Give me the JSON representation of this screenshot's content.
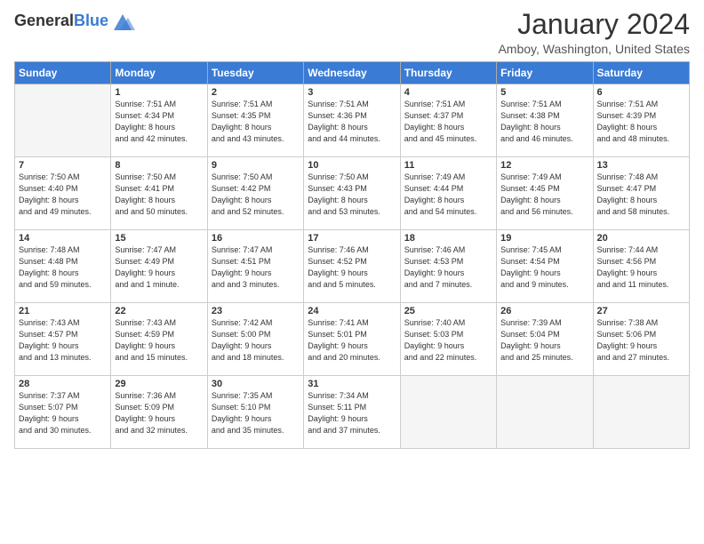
{
  "logo": {
    "general": "General",
    "blue": "Blue"
  },
  "header": {
    "month": "January 2024",
    "location": "Amboy, Washington, United States"
  },
  "days_of_week": [
    "Sunday",
    "Monday",
    "Tuesday",
    "Wednesday",
    "Thursday",
    "Friday",
    "Saturday"
  ],
  "weeks": [
    [
      {
        "day": "",
        "sunrise": "",
        "sunset": "",
        "daylight": ""
      },
      {
        "day": "1",
        "sunrise": "Sunrise: 7:51 AM",
        "sunset": "Sunset: 4:34 PM",
        "daylight": "Daylight: 8 hours and 42 minutes."
      },
      {
        "day": "2",
        "sunrise": "Sunrise: 7:51 AM",
        "sunset": "Sunset: 4:35 PM",
        "daylight": "Daylight: 8 hours and 43 minutes."
      },
      {
        "day": "3",
        "sunrise": "Sunrise: 7:51 AM",
        "sunset": "Sunset: 4:36 PM",
        "daylight": "Daylight: 8 hours and 44 minutes."
      },
      {
        "day": "4",
        "sunrise": "Sunrise: 7:51 AM",
        "sunset": "Sunset: 4:37 PM",
        "daylight": "Daylight: 8 hours and 45 minutes."
      },
      {
        "day": "5",
        "sunrise": "Sunrise: 7:51 AM",
        "sunset": "Sunset: 4:38 PM",
        "daylight": "Daylight: 8 hours and 46 minutes."
      },
      {
        "day": "6",
        "sunrise": "Sunrise: 7:51 AM",
        "sunset": "Sunset: 4:39 PM",
        "daylight": "Daylight: 8 hours and 48 minutes."
      }
    ],
    [
      {
        "day": "7",
        "sunrise": "Sunrise: 7:50 AM",
        "sunset": "Sunset: 4:40 PM",
        "daylight": "Daylight: 8 hours and 49 minutes."
      },
      {
        "day": "8",
        "sunrise": "Sunrise: 7:50 AM",
        "sunset": "Sunset: 4:41 PM",
        "daylight": "Daylight: 8 hours and 50 minutes."
      },
      {
        "day": "9",
        "sunrise": "Sunrise: 7:50 AM",
        "sunset": "Sunset: 4:42 PM",
        "daylight": "Daylight: 8 hours and 52 minutes."
      },
      {
        "day": "10",
        "sunrise": "Sunrise: 7:50 AM",
        "sunset": "Sunset: 4:43 PM",
        "daylight": "Daylight: 8 hours and 53 minutes."
      },
      {
        "day": "11",
        "sunrise": "Sunrise: 7:49 AM",
        "sunset": "Sunset: 4:44 PM",
        "daylight": "Daylight: 8 hours and 54 minutes."
      },
      {
        "day": "12",
        "sunrise": "Sunrise: 7:49 AM",
        "sunset": "Sunset: 4:45 PM",
        "daylight": "Daylight: 8 hours and 56 minutes."
      },
      {
        "day": "13",
        "sunrise": "Sunrise: 7:48 AM",
        "sunset": "Sunset: 4:47 PM",
        "daylight": "Daylight: 8 hours and 58 minutes."
      }
    ],
    [
      {
        "day": "14",
        "sunrise": "Sunrise: 7:48 AM",
        "sunset": "Sunset: 4:48 PM",
        "daylight": "Daylight: 8 hours and 59 minutes."
      },
      {
        "day": "15",
        "sunrise": "Sunrise: 7:47 AM",
        "sunset": "Sunset: 4:49 PM",
        "daylight": "Daylight: 9 hours and 1 minute."
      },
      {
        "day": "16",
        "sunrise": "Sunrise: 7:47 AM",
        "sunset": "Sunset: 4:51 PM",
        "daylight": "Daylight: 9 hours and 3 minutes."
      },
      {
        "day": "17",
        "sunrise": "Sunrise: 7:46 AM",
        "sunset": "Sunset: 4:52 PM",
        "daylight": "Daylight: 9 hours and 5 minutes."
      },
      {
        "day": "18",
        "sunrise": "Sunrise: 7:46 AM",
        "sunset": "Sunset: 4:53 PM",
        "daylight": "Daylight: 9 hours and 7 minutes."
      },
      {
        "day": "19",
        "sunrise": "Sunrise: 7:45 AM",
        "sunset": "Sunset: 4:54 PM",
        "daylight": "Daylight: 9 hours and 9 minutes."
      },
      {
        "day": "20",
        "sunrise": "Sunrise: 7:44 AM",
        "sunset": "Sunset: 4:56 PM",
        "daylight": "Daylight: 9 hours and 11 minutes."
      }
    ],
    [
      {
        "day": "21",
        "sunrise": "Sunrise: 7:43 AM",
        "sunset": "Sunset: 4:57 PM",
        "daylight": "Daylight: 9 hours and 13 minutes."
      },
      {
        "day": "22",
        "sunrise": "Sunrise: 7:43 AM",
        "sunset": "Sunset: 4:59 PM",
        "daylight": "Daylight: 9 hours and 15 minutes."
      },
      {
        "day": "23",
        "sunrise": "Sunrise: 7:42 AM",
        "sunset": "Sunset: 5:00 PM",
        "daylight": "Daylight: 9 hours and 18 minutes."
      },
      {
        "day": "24",
        "sunrise": "Sunrise: 7:41 AM",
        "sunset": "Sunset: 5:01 PM",
        "daylight": "Daylight: 9 hours and 20 minutes."
      },
      {
        "day": "25",
        "sunrise": "Sunrise: 7:40 AM",
        "sunset": "Sunset: 5:03 PM",
        "daylight": "Daylight: 9 hours and 22 minutes."
      },
      {
        "day": "26",
        "sunrise": "Sunrise: 7:39 AM",
        "sunset": "Sunset: 5:04 PM",
        "daylight": "Daylight: 9 hours and 25 minutes."
      },
      {
        "day": "27",
        "sunrise": "Sunrise: 7:38 AM",
        "sunset": "Sunset: 5:06 PM",
        "daylight": "Daylight: 9 hours and 27 minutes."
      }
    ],
    [
      {
        "day": "28",
        "sunrise": "Sunrise: 7:37 AM",
        "sunset": "Sunset: 5:07 PM",
        "daylight": "Daylight: 9 hours and 30 minutes."
      },
      {
        "day": "29",
        "sunrise": "Sunrise: 7:36 AM",
        "sunset": "Sunset: 5:09 PM",
        "daylight": "Daylight: 9 hours and 32 minutes."
      },
      {
        "day": "30",
        "sunrise": "Sunrise: 7:35 AM",
        "sunset": "Sunset: 5:10 PM",
        "daylight": "Daylight: 9 hours and 35 minutes."
      },
      {
        "day": "31",
        "sunrise": "Sunrise: 7:34 AM",
        "sunset": "Sunset: 5:11 PM",
        "daylight": "Daylight: 9 hours and 37 minutes."
      },
      {
        "day": "",
        "sunrise": "",
        "sunset": "",
        "daylight": ""
      },
      {
        "day": "",
        "sunrise": "",
        "sunset": "",
        "daylight": ""
      },
      {
        "day": "",
        "sunrise": "",
        "sunset": "",
        "daylight": ""
      }
    ]
  ]
}
